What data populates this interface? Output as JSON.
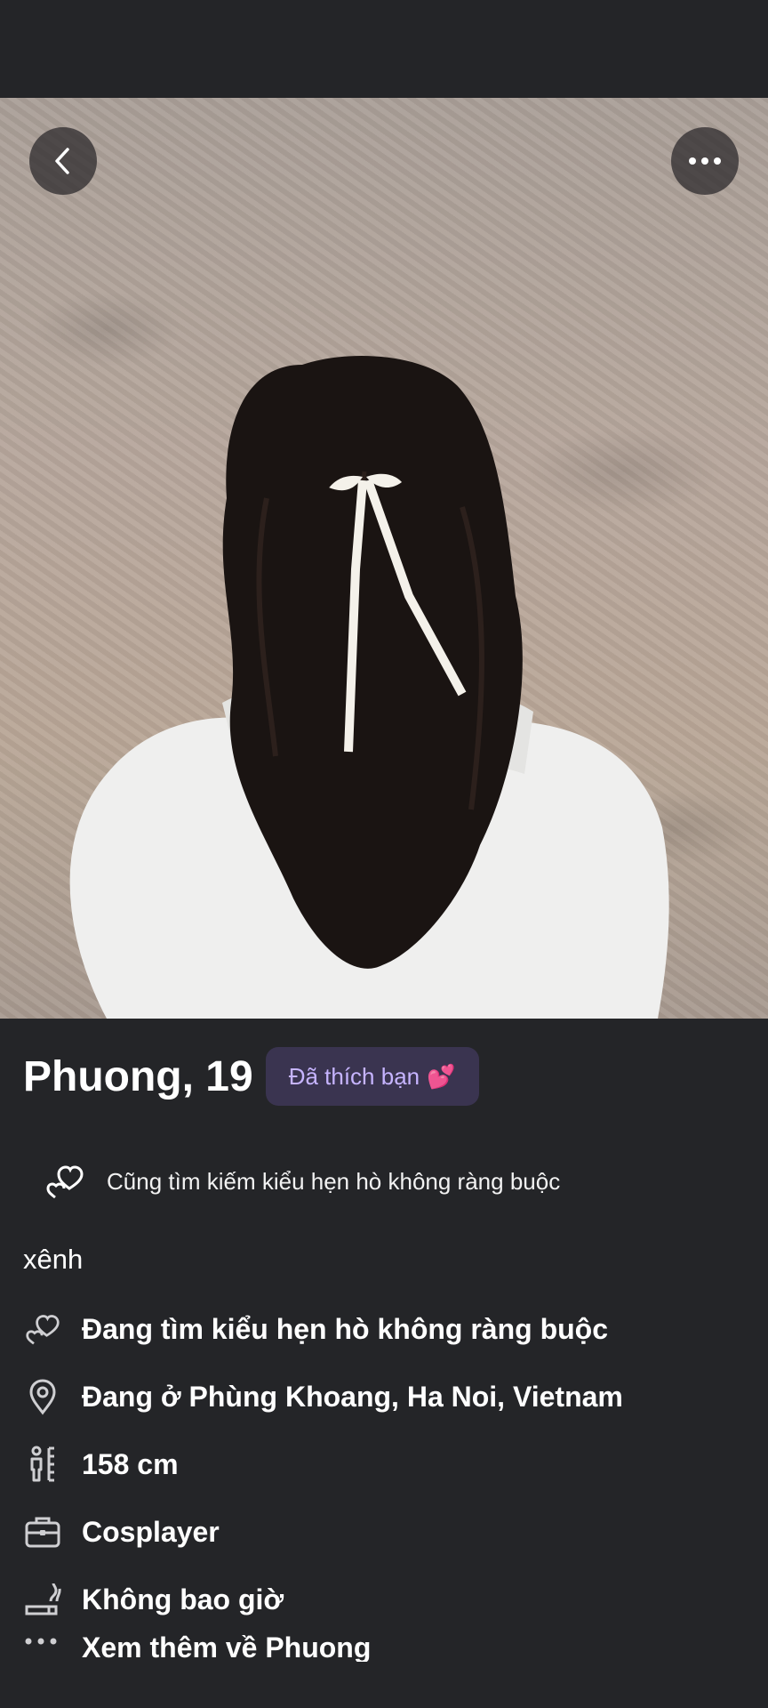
{
  "profile": {
    "name_age": "Phuong, 19",
    "liked_badge": "Đã thích bạn",
    "liked_badge_emoji": "💕",
    "also_looking": "Cũng tìm kiếm kiểu hẹn hò không ràng buộc",
    "bio": "xênh"
  },
  "details": [
    {
      "icon": "hearts-icon",
      "label": "Đang tìm kiểu hẹn hò không ràng buộc"
    },
    {
      "icon": "location-pin-icon",
      "label": "Đang ở Phùng Khoang, Ha Noi, Vietnam"
    },
    {
      "icon": "height-icon",
      "label": "158 cm"
    },
    {
      "icon": "briefcase-icon",
      "label": "Cosplayer"
    },
    {
      "icon": "smoking-icon",
      "label": "Không bao giờ"
    }
  ],
  "see_more": "Xem thêm về Phuong",
  "colors": {
    "background": "#242528",
    "badge_bg": "#3a3450",
    "badge_text": "#c6b4ff"
  }
}
